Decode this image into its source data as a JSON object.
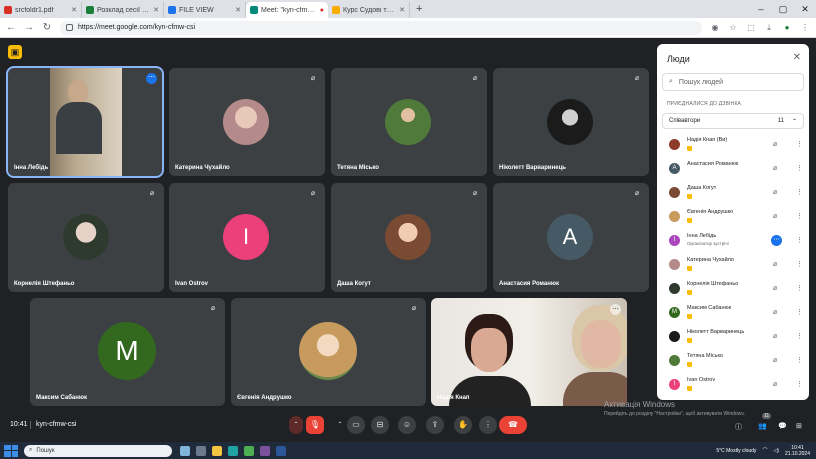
{
  "browser": {
    "tabs": [
      {
        "label": "srcfoldr1.pdf",
        "color": "#d93025"
      },
      {
        "label": "Розклад сесії Мукачево. Рівен",
        "color": "#188038"
      },
      {
        "label": "FILE VIEW",
        "color": "#1a73e8"
      },
      {
        "label": "Meet: \"kyn-cfmw-csi\"",
        "color": "#00897b"
      },
      {
        "label": "Курс Судові та правоохоронні",
        "color": "#f9ab00"
      }
    ],
    "url": "https://meet.google.com/kyn-cfmw-csi"
  },
  "tiles": [
    {
      "name": "Інна Лебідь",
      "type": "camera"
    },
    {
      "name": "Катерина Чухайло",
      "type": "photo",
      "color": "#b58a8a"
    },
    {
      "name": "Тетяна Місько",
      "type": "photo",
      "color": "#4f7a3a"
    },
    {
      "name": "Ніколетт Варваринець",
      "type": "photo",
      "color": "#1b1b1b"
    },
    {
      "name": "Корнелія Штефаньо",
      "type": "photo",
      "color": "#2f3a2f"
    },
    {
      "name": "Ivan Ostrov",
      "type": "letter",
      "letter": "I",
      "color": "#ec407a"
    },
    {
      "name": "Даша Когут",
      "type": "photo",
      "color": "#7a4a32"
    },
    {
      "name": "Анастасия Романюк",
      "type": "letter",
      "letter": "А",
      "color": "#455a64"
    },
    {
      "name": "Максим Сабанюк",
      "type": "letter",
      "letter": "М",
      "color": "#33691e"
    },
    {
      "name": "Євгенія Андрушко",
      "type": "photo",
      "color": "#c79a5e"
    },
    {
      "name": "Надія Кнап",
      "type": "camera2"
    }
  ],
  "panel": {
    "title": "Люди",
    "search_placeholder": "Пошук людей",
    "section": "ПРИЄДНАЛИСЯ ДО ДЗВІНКА",
    "group_label": "Співавтори",
    "group_count": "11",
    "people": [
      {
        "name": "Надія Кнап (Ви)",
        "letter": "",
        "color": "#8d3b2a",
        "badge": true
      },
      {
        "name": "Анастасия Романюк",
        "letter": "А",
        "color": "#455a64",
        "badge": false
      },
      {
        "name": "Даша Когут",
        "letter": "",
        "color": "#7a4a32",
        "badge": true
      },
      {
        "name": "Євгенія Андрушко",
        "letter": "",
        "color": "#c79a5e",
        "badge": true
      },
      {
        "name": "Інна Лебідь",
        "role": "Організатор зустрічі",
        "letter": "І",
        "color": "#ab47bc",
        "speaking": true
      },
      {
        "name": "Катерина Чухайло",
        "letter": "",
        "color": "#b58a8a",
        "badge": true
      },
      {
        "name": "Корнелія Штефаньо",
        "letter": "",
        "color": "#2f3a2f",
        "badge": true
      },
      {
        "name": "Максим Сабанюк",
        "letter": "М",
        "color": "#33691e",
        "badge": true
      },
      {
        "name": "Ніколетт Варваринець",
        "letter": "",
        "color": "#1b1b1b",
        "badge": true
      },
      {
        "name": "Тетяна Місько",
        "letter": "",
        "color": "#4f7a3a",
        "badge": true
      },
      {
        "name": "Ivan Ostrov",
        "letter": "I",
        "color": "#ec407a",
        "badge": true
      }
    ]
  },
  "bottom": {
    "time": "10:41",
    "meeting_code": "kyn-cfmw-csi",
    "participants_count": "11"
  },
  "watermark": {
    "title": "Активація Windows",
    "subtitle": "Перейдіть до розділу \"Настройки\", щоб активувати Windows."
  },
  "taskbar": {
    "search": "Пошук",
    "weather": "5°C  Mostly cloudy",
    "time": "10:41",
    "date": "21.10.2024"
  }
}
